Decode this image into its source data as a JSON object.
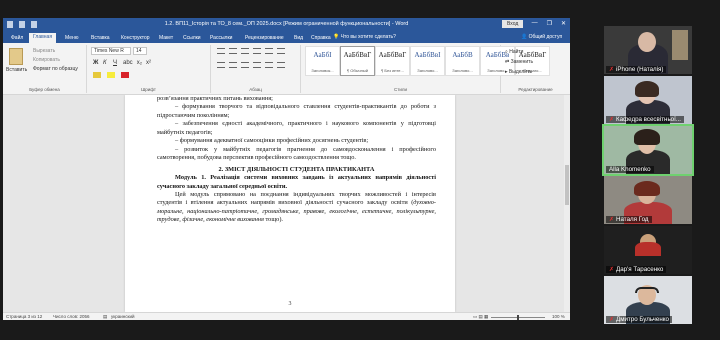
{
  "word": {
    "title": "1.2. ВП11_Історія та ТО_8 сем._ОП 2025.docx [Режим ограниченной функциональности] - Word",
    "login_label": "Вход",
    "window_buttons": [
      "—",
      "❐",
      "✕"
    ],
    "tabs": [
      "Файл",
      "Главная",
      "Меню",
      "Вставка",
      "Конструктор",
      "Макет",
      "Ссылки",
      "Рассылки",
      "Рецензирование",
      "Вид",
      "Справка"
    ],
    "active_tab": "Главная",
    "tell_me": "Что вы хотите сделать?",
    "share": "Общий доступ",
    "ribbon": {
      "paste_label": "Вставить",
      "clipboard_items": [
        "Вырезать",
        "Копировать",
        "Формат по образцу"
      ],
      "clipboard_group": "Буфер обмена",
      "font_name": "Times New R",
      "font_size": "14",
      "font_group": "Шрифт",
      "paragraph_group": "Абзац",
      "styles_group": "Стили",
      "styles": [
        {
          "sample": "АаБбІ",
          "name": "Заголовок...",
          "heading": true
        },
        {
          "sample": "АаБбВвГ",
          "name": "¶ Обычный",
          "heading": false
        },
        {
          "sample": "АаБбВвГ",
          "name": "¶ Без инте...",
          "heading": false
        },
        {
          "sample": "АаБбВвІ",
          "name": "Заголово...",
          "heading": true
        },
        {
          "sample": "АаБбВ",
          "name": "Заголово...",
          "heading": true
        },
        {
          "sample": "АаБбВв",
          "name": "Заголово...",
          "heading": true
        },
        {
          "sample": "АаБбВвГ",
          "name": "Подзаго...",
          "heading": false
        }
      ],
      "edit_items": [
        "Найти",
        "Заменить",
        "Выделить"
      ],
      "edit_group": "Редактирование"
    },
    "document": {
      "lines": [
        {
          "cls": "",
          "text": "розв’язання практичних питань виховання;"
        },
        {
          "cls": "dash",
          "text": "–        формування творчого та відповідального ставлення студентів-практикантів до роботи з підростаючим поколінням;"
        },
        {
          "cls": "dash",
          "text": "–        забезпечення єдності академічного, практичного і наукового компонентів у підготовці майбутніх педагогів;"
        },
        {
          "cls": "dash",
          "text": "–        формування адекватної самооцінки професійних досягнень студентів;"
        },
        {
          "cls": "dash",
          "text": "–        розвиток у майбутніх педагогів прагнення до самовдосконалення і професійного самотворення, побудова перспектив професійного самоздоствлення тощо."
        },
        {
          "cls": "heading",
          "text": "2. ЗМІСТ ДІЯЛЬНОСТІ СТУДЕНТА ПРАКТИКАНТА"
        },
        {
          "cls": "bold",
          "text": "Модуль 1. Реалізація системи виховних завдань із актуальних напрямів діяльності сучасного закладу загальної середньої освіти."
        }
      ],
      "last_para_start": "Цей модуль спрямовано на поєднання індивідуальних творчих можливостей і інтересів студентів і втілення актуальних напрямів виховної діяльності сучасного закладу освіти (",
      "last_para_italic": "духовно-моральне, національно-патріотичне, громадянське, правове, екологічне, естетичне, полікультурне, трудове, фізичне, економічне виховання",
      "last_para_end": " тощо).",
      "page_number": "3"
    },
    "status": {
      "page": "Страница 3 из 12",
      "words": "Число слов: 2056",
      "language": "украинский",
      "zoom": "100 %"
    }
  },
  "participants": [
    {
      "name": "iPhone (Наталія)",
      "muted": true
    },
    {
      "name": "Кафедра всесвітньої...",
      "muted": true
    },
    {
      "name": "Alla Khomenko",
      "muted": false,
      "speaking": true
    },
    {
      "name": "Наталя Год",
      "muted": true
    },
    {
      "name": "Дар'я Тарасенко",
      "muted": true
    },
    {
      "name": "Дмитро Бульченко",
      "muted": true
    }
  ],
  "colors": {
    "word_blue": "#2b579a",
    "mute_red": "#e03030",
    "speaking_green": "#6fd16f"
  }
}
